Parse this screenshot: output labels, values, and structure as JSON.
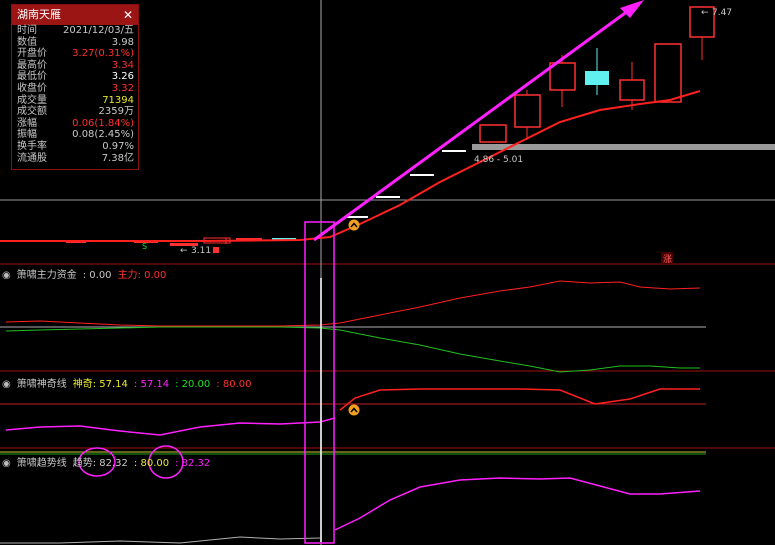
{
  "info_panel": {
    "title": "湖南天雁",
    "close_glyph": "✕",
    "rows": [
      {
        "label": "时间",
        "value": "2021/12/03/五",
        "color": "#c8c8c8"
      },
      {
        "label": "数值",
        "value": "3.98",
        "color": "#c8c8c8"
      },
      {
        "label": "开盘价",
        "value": "3.27(0.31%)",
        "color": "#ff3030"
      },
      {
        "label": "最高价",
        "value": "3.34",
        "color": "#ff3030"
      },
      {
        "label": "最低价",
        "value": "3.26",
        "color": "#ffffff"
      },
      {
        "label": "收盘价",
        "value": "3.32",
        "color": "#ff3030"
      },
      {
        "label": "成交量",
        "value": "71394",
        "color": "#e8e830"
      },
      {
        "label": "成交额",
        "value": "2359万",
        "color": "#c8c8c8"
      },
      {
        "label": "涨幅",
        "value": "0.06(1.84%)",
        "color": "#ff3030"
      },
      {
        "label": "振幅",
        "value": "0.08(2.45%)",
        "color": "#c8c8c8"
      },
      {
        "label": "换手率",
        "value": "0.97%",
        "color": "#c8c8c8"
      },
      {
        "label": "流通股",
        "value": "7.38亿",
        "color": "#c8c8c8"
      }
    ]
  },
  "main_chart": {
    "annotation_high": "7.47",
    "annotation_low": "3.11",
    "price_range": "4.86 - 5.01",
    "rise_marker": "涨",
    "buy_marker_small": "S"
  },
  "panes": {
    "fund": {
      "name": "箫啸主力资金",
      "value_text": ": 0.00",
      "sub_name": "主力",
      "sub_value": ": 0.00"
    },
    "magic": {
      "name": "箫啸神奇线",
      "sub_name": "神奇",
      "v1": ": 57.14",
      "v2": ": 57.14",
      "v3": ": 20.00",
      "v4": ": 80.00"
    },
    "trend": {
      "name": "箫啸趋势线",
      "sub_name": "趋势",
      "v1": ": 82.32",
      "v2": ": 80.00",
      "v3": ": 82.32"
    }
  },
  "colors": {
    "up": "#ff3030",
    "down": "#60f0f0",
    "magenta": "#ff20ff",
    "yellow": "#e8e830",
    "green": "#20c020",
    "grid_red": "#a01010"
  }
}
